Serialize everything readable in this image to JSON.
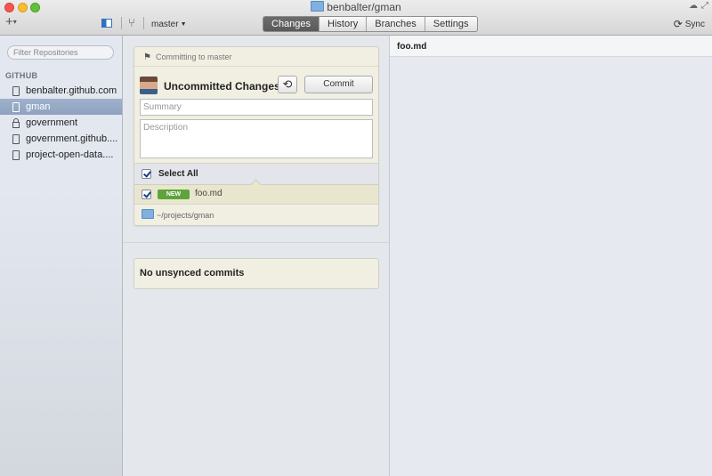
{
  "window": {
    "title": "benbalter/gman"
  },
  "toolbar": {
    "add_icon": "plus-icon",
    "branch": "master",
    "tabs": [
      {
        "label": "Changes",
        "active": true
      },
      {
        "label": "History",
        "active": false
      },
      {
        "label": "Branches",
        "active": false
      },
      {
        "label": "Settings",
        "active": false
      }
    ],
    "sync_label": "Sync"
  },
  "sidebar": {
    "filter_placeholder": "Filter Repositories",
    "group": "GITHUB",
    "items": [
      {
        "label": "benbalter.github.com",
        "icon": "repo-icon",
        "selected": false
      },
      {
        "label": "gman",
        "icon": "repo-icon",
        "selected": true
      },
      {
        "label": "government",
        "icon": "lock-icon",
        "selected": false
      },
      {
        "label": "government.github....",
        "icon": "repo-icon",
        "selected": false
      },
      {
        "label": "project-open-data....",
        "icon": "repo-icon",
        "selected": false
      }
    ]
  },
  "changes": {
    "committing_to": "Committing to master",
    "title": "Uncommitted Changes",
    "commit_label": "Commit",
    "summary_placeholder": "Summary",
    "description_placeholder": "Description",
    "select_all": "Select All",
    "files": [
      {
        "badge": "NEW",
        "name": "foo.md",
        "checked": true
      }
    ],
    "path": "~/projects/gman",
    "unsynced": "No unsynced commits"
  },
  "diff": {
    "file": "foo.md"
  },
  "colors": {
    "new_badge": "#5ea43a",
    "selection": "#8ea2bf",
    "panel": "#f0efe2"
  }
}
